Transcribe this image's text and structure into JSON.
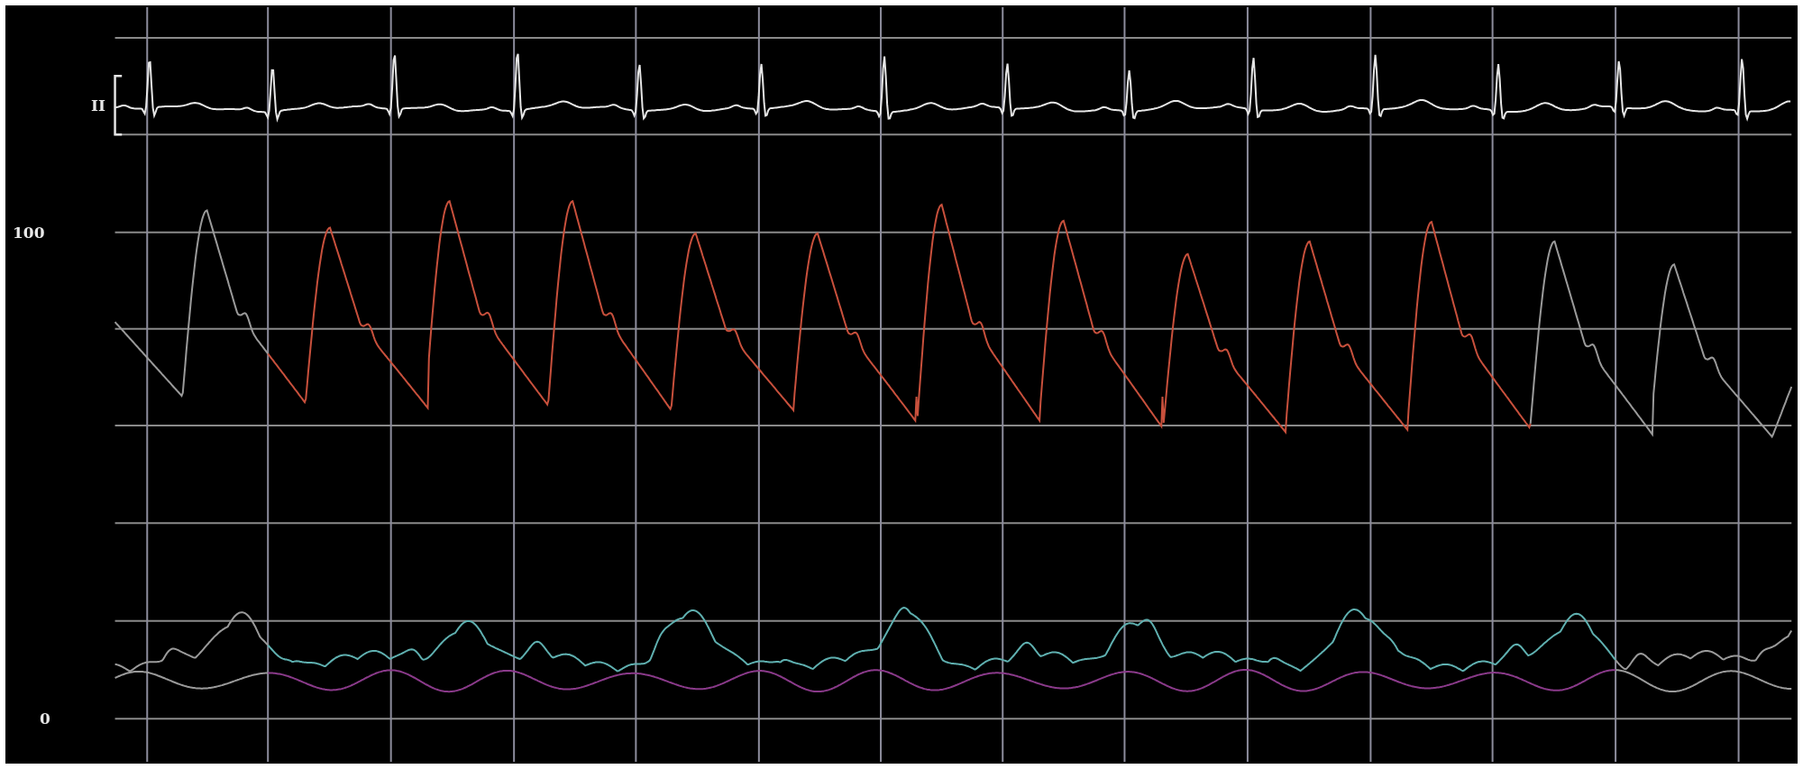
{
  "ecg": {
    "lead": "II"
  },
  "pressure_scale": {
    "labels": [
      "100",
      "0"
    ]
  }
}
